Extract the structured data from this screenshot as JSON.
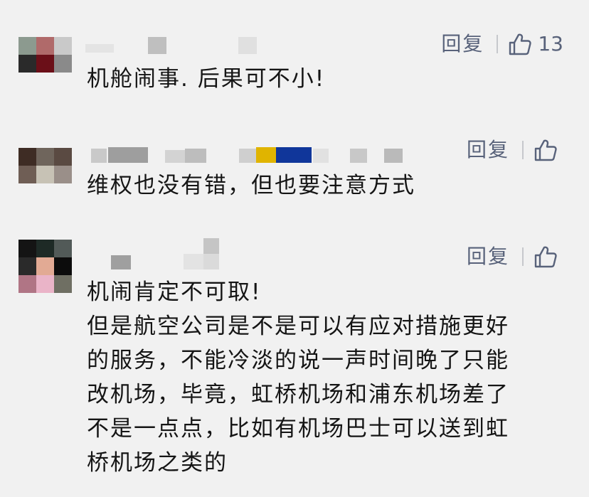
{
  "comments": [
    {
      "reply_label": "回复",
      "like_count": "13",
      "text_lines": [
        "机舱闹事. 后果可不小!"
      ]
    },
    {
      "reply_label": "回复",
      "like_count": "",
      "text_lines": [
        "维权也没有错，但也要注意方式"
      ]
    },
    {
      "reply_label": "回复",
      "like_count": "",
      "text_lines": [
        "机闹肯定不可取!",
        "但是航空公司是不是可以有应对措施更好",
        "的服务，不能冷淡的说一声时间晚了只能",
        "改机场，毕竟，虹桥机场和浦东机场差了",
        "不是一点点，比如有机场巴士可以送到虹",
        "桥机场之类的"
      ]
    }
  ],
  "icons": {
    "like": "thumbs-up-icon"
  },
  "colors": {
    "background": "#f1f1f1",
    "action_text": "#58627a",
    "body_text": "#151515",
    "separator": "#c6c8cc"
  }
}
